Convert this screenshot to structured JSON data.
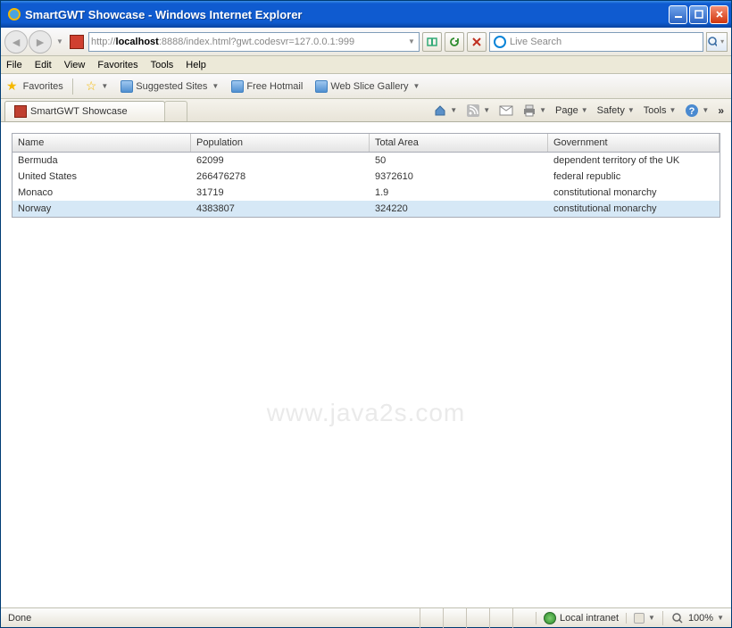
{
  "window": {
    "title": "SmartGWT Showcase - Windows Internet Explorer"
  },
  "address": {
    "prefix": "http://",
    "host": "localhost",
    "suffix": ":8888/index.html?gwt.codesvr=127.0.0.1:999"
  },
  "search": {
    "placeholder": "Live Search"
  },
  "menubar": {
    "file": "File",
    "edit": "Edit",
    "view": "View",
    "favorites": "Favorites",
    "tools": "Tools",
    "help": "Help"
  },
  "favbar": {
    "favorites": "Favorites",
    "suggested": "Suggested Sites",
    "hotmail": "Free Hotmail",
    "webslice": "Web Slice Gallery"
  },
  "tab": {
    "title": "SmartGWT Showcase"
  },
  "cmdbar": {
    "page": "Page",
    "safety": "Safety",
    "tools": "Tools"
  },
  "grid": {
    "headers": {
      "name": "Name",
      "population": "Population",
      "area": "Total Area",
      "gov": "Government"
    },
    "rows": [
      {
        "name": "Bermuda",
        "population": "62099",
        "area": "50",
        "gov": "dependent territory of the UK"
      },
      {
        "name": "United States",
        "population": "266476278",
        "area": "9372610",
        "gov": "federal republic"
      },
      {
        "name": "Monaco",
        "population": "31719",
        "area": "1.9",
        "gov": "constitutional monarchy"
      },
      {
        "name": "Norway",
        "population": "4383807",
        "area": "324220",
        "gov": "constitutional monarchy"
      }
    ]
  },
  "watermark": "www.java2s.com",
  "status": {
    "done": "Done",
    "zone": "Local intranet",
    "zoom": "100%"
  }
}
